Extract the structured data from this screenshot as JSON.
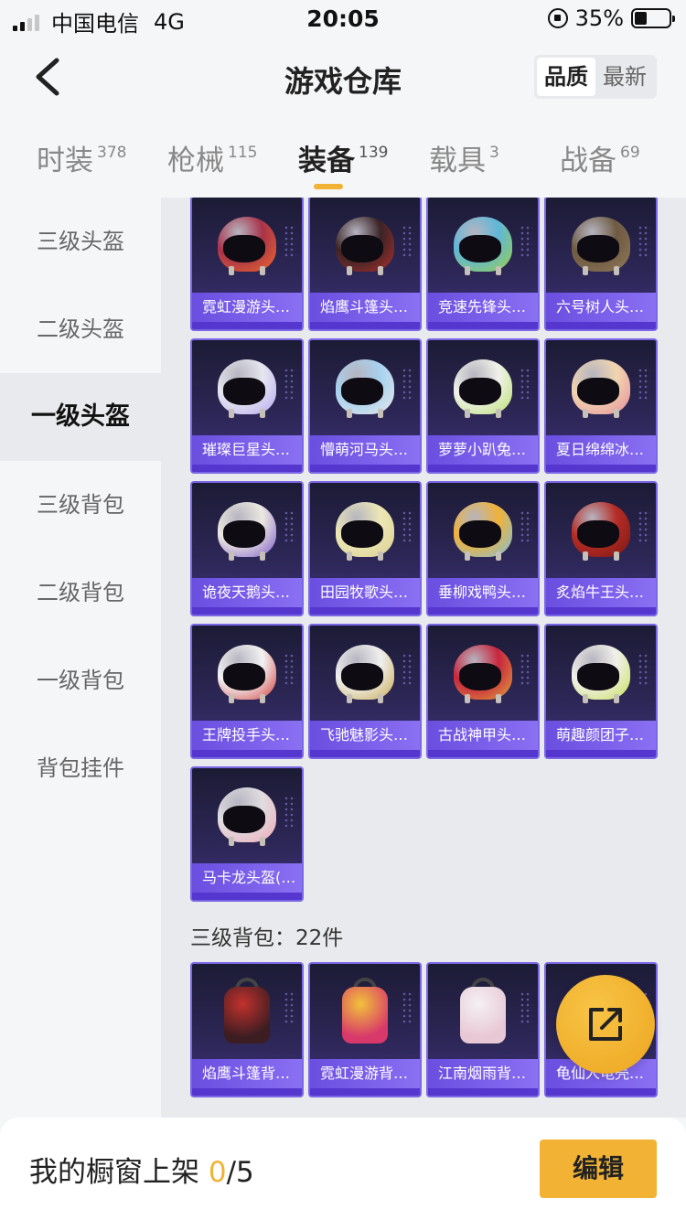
{
  "status_bar": {
    "carrier": "中国电信",
    "network": "4G",
    "time": "20:05",
    "battery": "35%",
    "battery_level": 0.35
  },
  "header": {
    "title": "游戏仓库",
    "sort_options": [
      "品质",
      "最新"
    ],
    "sort_active": "品质"
  },
  "tabs": [
    {
      "label": "时装",
      "count": "378"
    },
    {
      "label": "枪械",
      "count": "115"
    },
    {
      "label": "装备",
      "count": "139",
      "active": true
    },
    {
      "label": "载具",
      "count": "3"
    },
    {
      "label": "战备",
      "count": "69"
    }
  ],
  "sidebar": {
    "items": [
      "三级头盔",
      "二级头盔",
      "一级头盔",
      "三级背包",
      "二级背包",
      "一级背包",
      "背包挂件"
    ],
    "active": "一级头盔"
  },
  "helmets": [
    {
      "name": "霓虹漫游头…",
      "shell": "#a8334a",
      "accent": "#f06a2a"
    },
    {
      "name": "焰鹰斗篷头…",
      "shell": "#3a2426",
      "accent": "#b0302b"
    },
    {
      "name": "竞速先锋头…",
      "shell": "#5fb7d8",
      "accent": "#9ed040"
    },
    {
      "name": "六号树人头…",
      "shell": "#6e5a42",
      "accent": "#927a5a"
    },
    {
      "name": "璀璨巨星头…",
      "shell": "#e6e6ef",
      "accent": "#b6a8f0"
    },
    {
      "name": "懵萌河马头…",
      "shell": "#a8d2ef",
      "accent": "#e8e8e8"
    },
    {
      "name": "萝萝小趴兔…",
      "shell": "#f0f1ea",
      "accent": "#b8e06a"
    },
    {
      "name": "夏日绵绵冰…",
      "shell": "#f1d5b0",
      "accent": "#e68a9a"
    },
    {
      "name": "诡夜天鹅头…",
      "shell": "#ece8e0",
      "accent": "#7a58c8"
    },
    {
      "name": "田园牧歌头…",
      "shell": "#ede7b6",
      "accent": "#d9cf8e"
    },
    {
      "name": "垂柳戏鸭头…",
      "shell": "#efb23a",
      "accent": "#7cc0e4"
    },
    {
      "name": "炙焰牛王头…",
      "shell": "#b52c26",
      "accent": "#7a1712"
    },
    {
      "name": "王牌投手头…",
      "shell": "#f2f2f2",
      "accent": "#d23a3a"
    },
    {
      "name": "飞驰魅影头…",
      "shell": "#efefef",
      "accent": "#c9a94a"
    },
    {
      "name": "古战神甲头…",
      "shell": "#c8263e",
      "accent": "#e0a43a"
    },
    {
      "name": "萌趣颜团子…",
      "shell": "#f2f0ea",
      "accent": "#c5e052"
    },
    {
      "name": "马卡龙头盔(…",
      "shell": "#e0dde0",
      "accent": "#f0a6b8"
    }
  ],
  "backpack_section": {
    "title": "三级背包：22件"
  },
  "backpacks": [
    {
      "name": "焰鹰斗篷背…",
      "shell": "#3c1d22",
      "accent": "#c2312c"
    },
    {
      "name": "霓虹漫游背…",
      "shell": "#d8386a",
      "accent": "#f1c23a"
    },
    {
      "name": "江南烟雨背…",
      "shell": "#e8c8d4",
      "accent": "#f4f0f4"
    },
    {
      "name": "龟仙人龟壳…",
      "shell": "#4e8a3a",
      "accent": "#d9b060"
    }
  ],
  "bottom_bar": {
    "label": "我的橱窗上架",
    "count": "0",
    "total": "/5",
    "edit_label": "编辑"
  }
}
